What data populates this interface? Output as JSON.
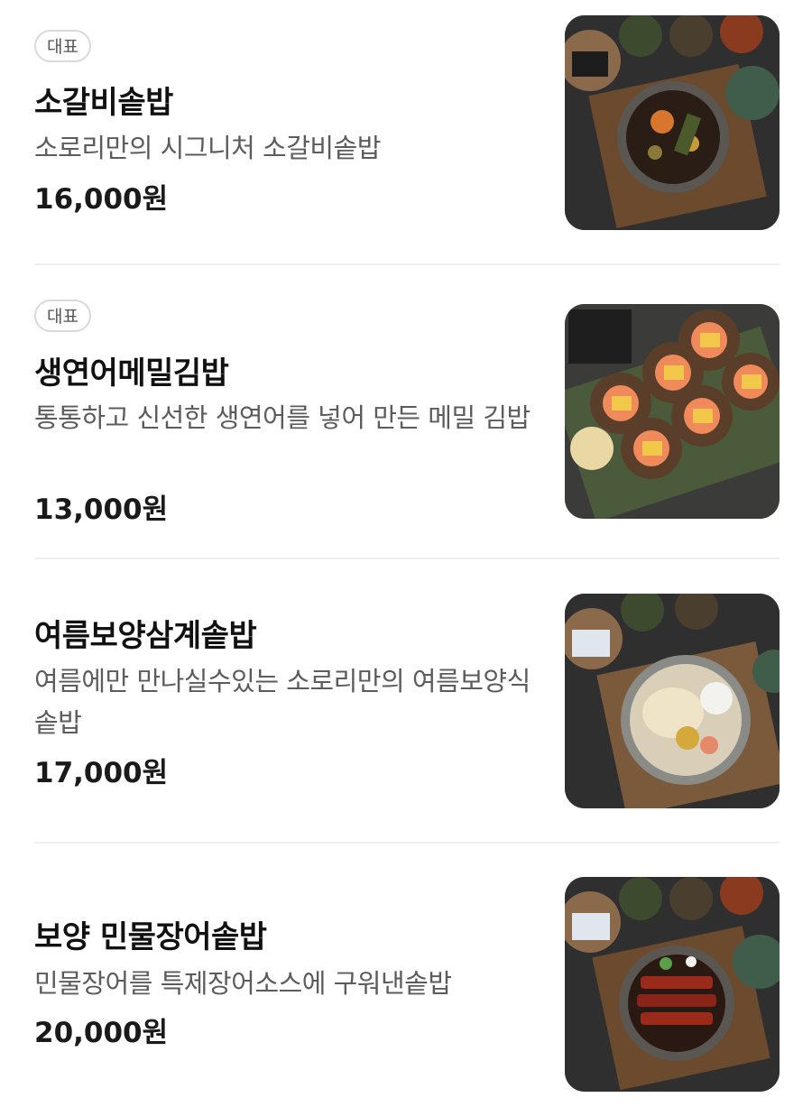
{
  "menu": {
    "items": [
      {
        "badge": "대표",
        "name": "소갈비솥밥",
        "description": "소로리만의 시그니처 소갈비솥밥",
        "price": "16,000원",
        "image_icon": "beef-rib-pot-rice-photo"
      },
      {
        "badge": "대표",
        "name": "생연어메밀김밥",
        "description": "통통하고 신선한 생연어를 넣어 만든 메밀 김밥",
        "price": "13,000원",
        "image_icon": "salmon-buckwheat-gimbap-photo"
      },
      {
        "name": "여름보양삼계솥밥",
        "description": "여름에만 만나실수있는 소로리만의 여름보양식 솥밥",
        "price": "17,000원",
        "image_icon": "samgye-pot-rice-photo"
      },
      {
        "name": "보양 민물장어솥밥",
        "description": "민물장어를 특제장어소스에 구워낸솥밥",
        "price": "20,000원",
        "image_icon": "eel-pot-rice-photo"
      }
    ]
  },
  "colors": {
    "text_primary": "#111111",
    "text_secondary": "#5c5c5c",
    "badge_border": "#d9d9d9",
    "divider": "#f0f0f0"
  }
}
